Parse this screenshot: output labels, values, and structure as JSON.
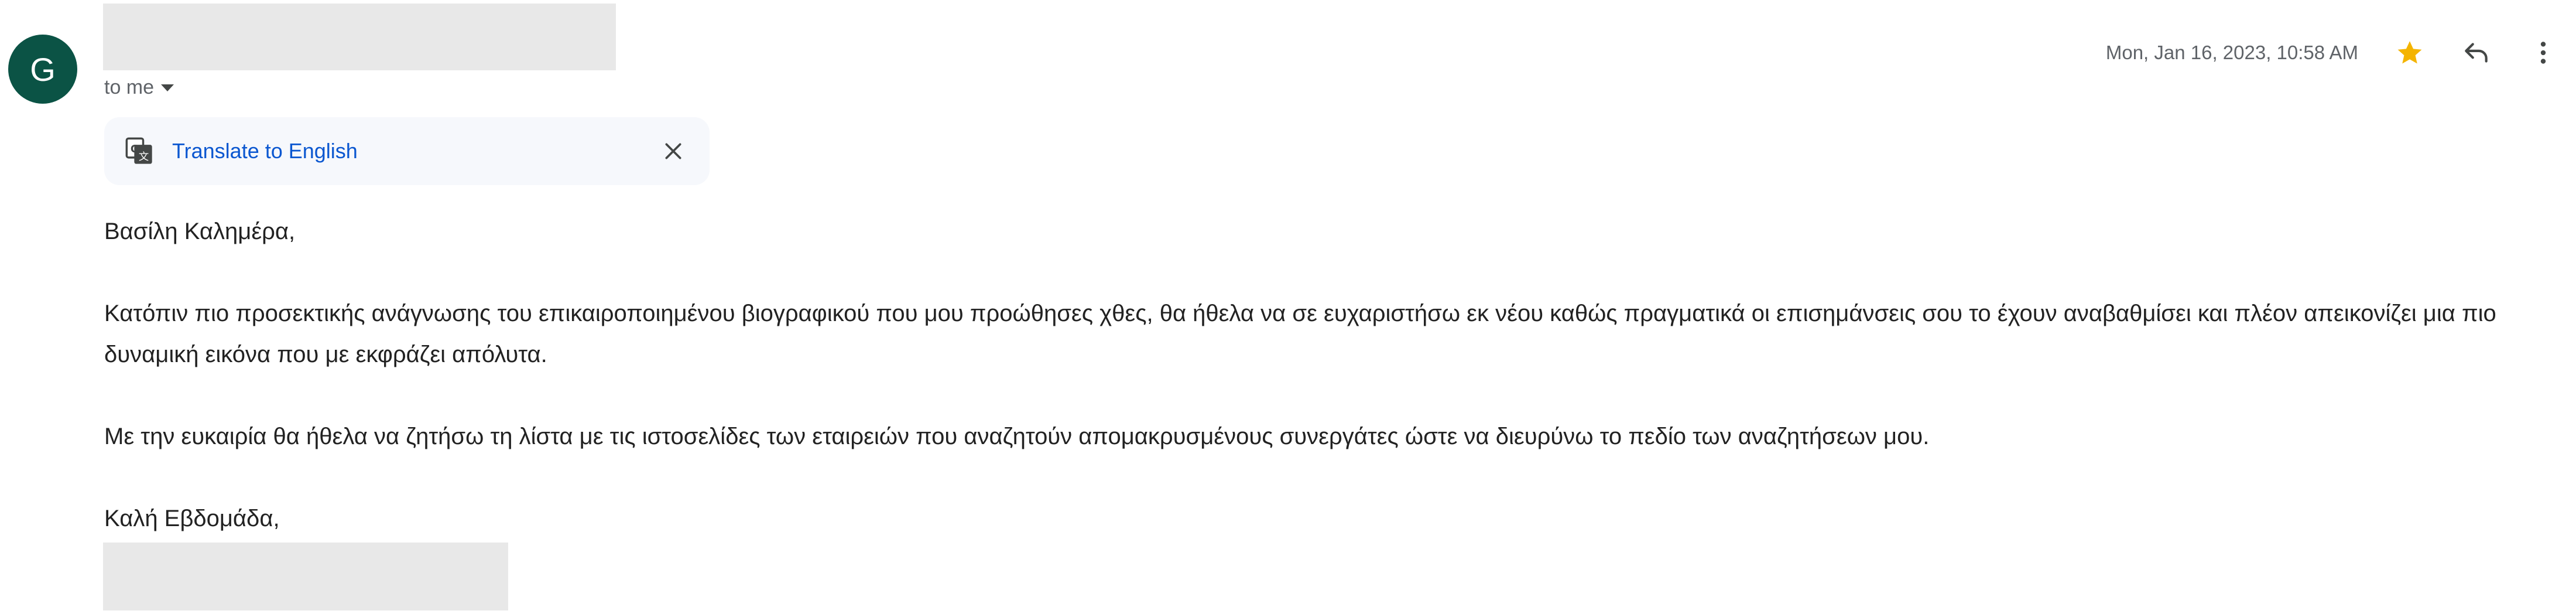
{
  "sender": {
    "avatar_letter": "G",
    "avatar_color": "#0b5345"
  },
  "recipient": {
    "label": "to me"
  },
  "header": {
    "date": "Mon, Jan 16, 2023, 10:58 AM",
    "star_color": "#f4b400",
    "icons": [
      "star-icon",
      "reply-icon",
      "more-vert-icon"
    ]
  },
  "translate": {
    "link_text": "Translate to English",
    "link_color": "#0b57d0",
    "icons": [
      "translate-icon",
      "close-icon"
    ]
  },
  "message": {
    "greeting": "Βασίλη Καλημέρα,",
    "paragraph1": "Κατόπιν πιο προσεκτικής ανάγνωσης του επικαιροποιημένου βιογραφικού που μου προώθησες χθες, θα ήθελα να σε ευχαριστήσω εκ νέου καθώς πραγματικά οι επισημάνσεις σου το έχουν αναβαθμίσει και πλέον απεικονίζει μια πιο δυναμική εικόνα που με εκφράζει απόλυτα.",
    "paragraph2": "Με την ευκαιρία θα ήθελα να ζητήσω τη λίστα με τις ιστοσελίδες των εταιρειών που αναζητούν απομακρυσμένους συνεργάτες ώστε να διευρύνω το πεδίο των αναζητήσεων μου.",
    "signoff": "Καλή Εβδομάδα,"
  }
}
